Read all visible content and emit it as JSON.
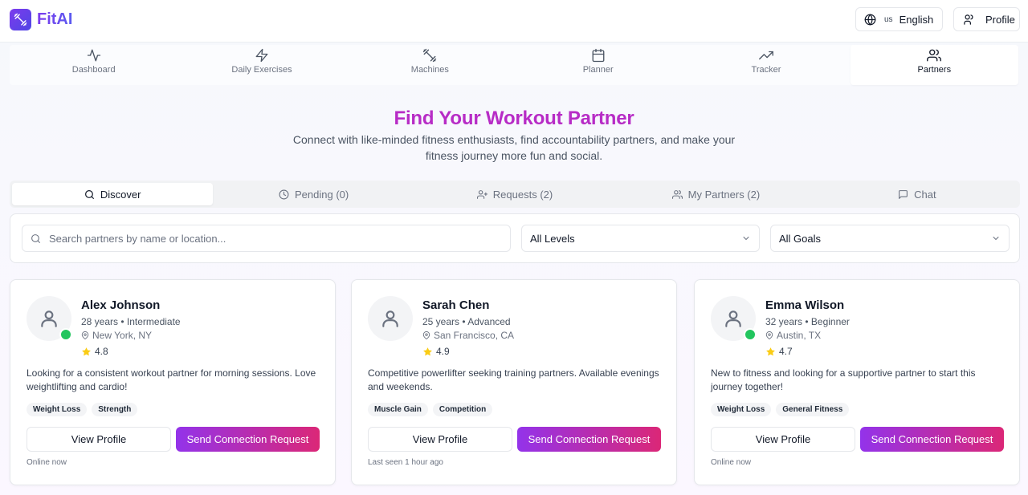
{
  "app": {
    "name": "FitAI",
    "brand_gradient": [
      "#7c3aed",
      "#4f46e5"
    ]
  },
  "header": {
    "language_code": "us",
    "language_label": "English",
    "profile_label": "Profile"
  },
  "nav": {
    "items": [
      {
        "label": "Dashboard",
        "icon": "activity-icon"
      },
      {
        "label": "Daily Exercises",
        "icon": "lightning-icon"
      },
      {
        "label": "Machines",
        "icon": "dumbbell-icon"
      },
      {
        "label": "Planner",
        "icon": "calendar-icon"
      },
      {
        "label": "Tracker",
        "icon": "trending-up-icon"
      },
      {
        "label": "Partners",
        "icon": "users-icon",
        "active": true
      }
    ]
  },
  "hero": {
    "title": "Find Your Workout Partner",
    "subtitle": "Connect with like-minded fitness enthusiasts, find accountability partners, and make your fitness journey more fun and social."
  },
  "tabs": [
    {
      "label": "Discover",
      "icon": "search-icon",
      "active": true
    },
    {
      "label": "Pending (0)",
      "icon": "clock-icon"
    },
    {
      "label": "Requests (2)",
      "icon": "user-plus-icon"
    },
    {
      "label": "My Partners (2)",
      "icon": "users-icon"
    },
    {
      "label": "Chat",
      "icon": "message-icon"
    }
  ],
  "filters": {
    "search_placeholder": "Search partners by name or location...",
    "search_value": "",
    "level_selected": "All Levels",
    "goal_selected": "All Goals"
  },
  "buttons": {
    "view_profile": "View Profile",
    "send_request": "Send Connection Request"
  },
  "partners": [
    {
      "name": "Alex Johnson",
      "meta": "28 years • Intermediate",
      "location": "New York, NY",
      "rating": "4.8",
      "bio": "Looking for a consistent workout partner for morning sessions. Love weightlifting and cardio!",
      "tags": [
        "Weight Loss",
        "Strength"
      ],
      "status": "Online now",
      "online": true
    },
    {
      "name": "Sarah Chen",
      "meta": "25 years • Advanced",
      "location": "San Francisco, CA",
      "rating": "4.9",
      "bio": "Competitive powerlifter seeking training partners. Available evenings and weekends.",
      "tags": [
        "Muscle Gain",
        "Competition"
      ],
      "status": "Last seen 1 hour ago",
      "online": false
    },
    {
      "name": "Emma Wilson",
      "meta": "32 years • Beginner",
      "location": "Austin, TX",
      "rating": "4.7",
      "bio": "New to fitness and looking for a supportive partner to start this journey together!",
      "tags": [
        "Weight Loss",
        "General Fitness"
      ],
      "status": "Online now",
      "online": true
    }
  ],
  "colors": {
    "accent_title": "#b72cc6",
    "button_gradient": [
      "#9333ea",
      "#db2777"
    ],
    "online": "#22c55e",
    "star": "#facc15"
  }
}
